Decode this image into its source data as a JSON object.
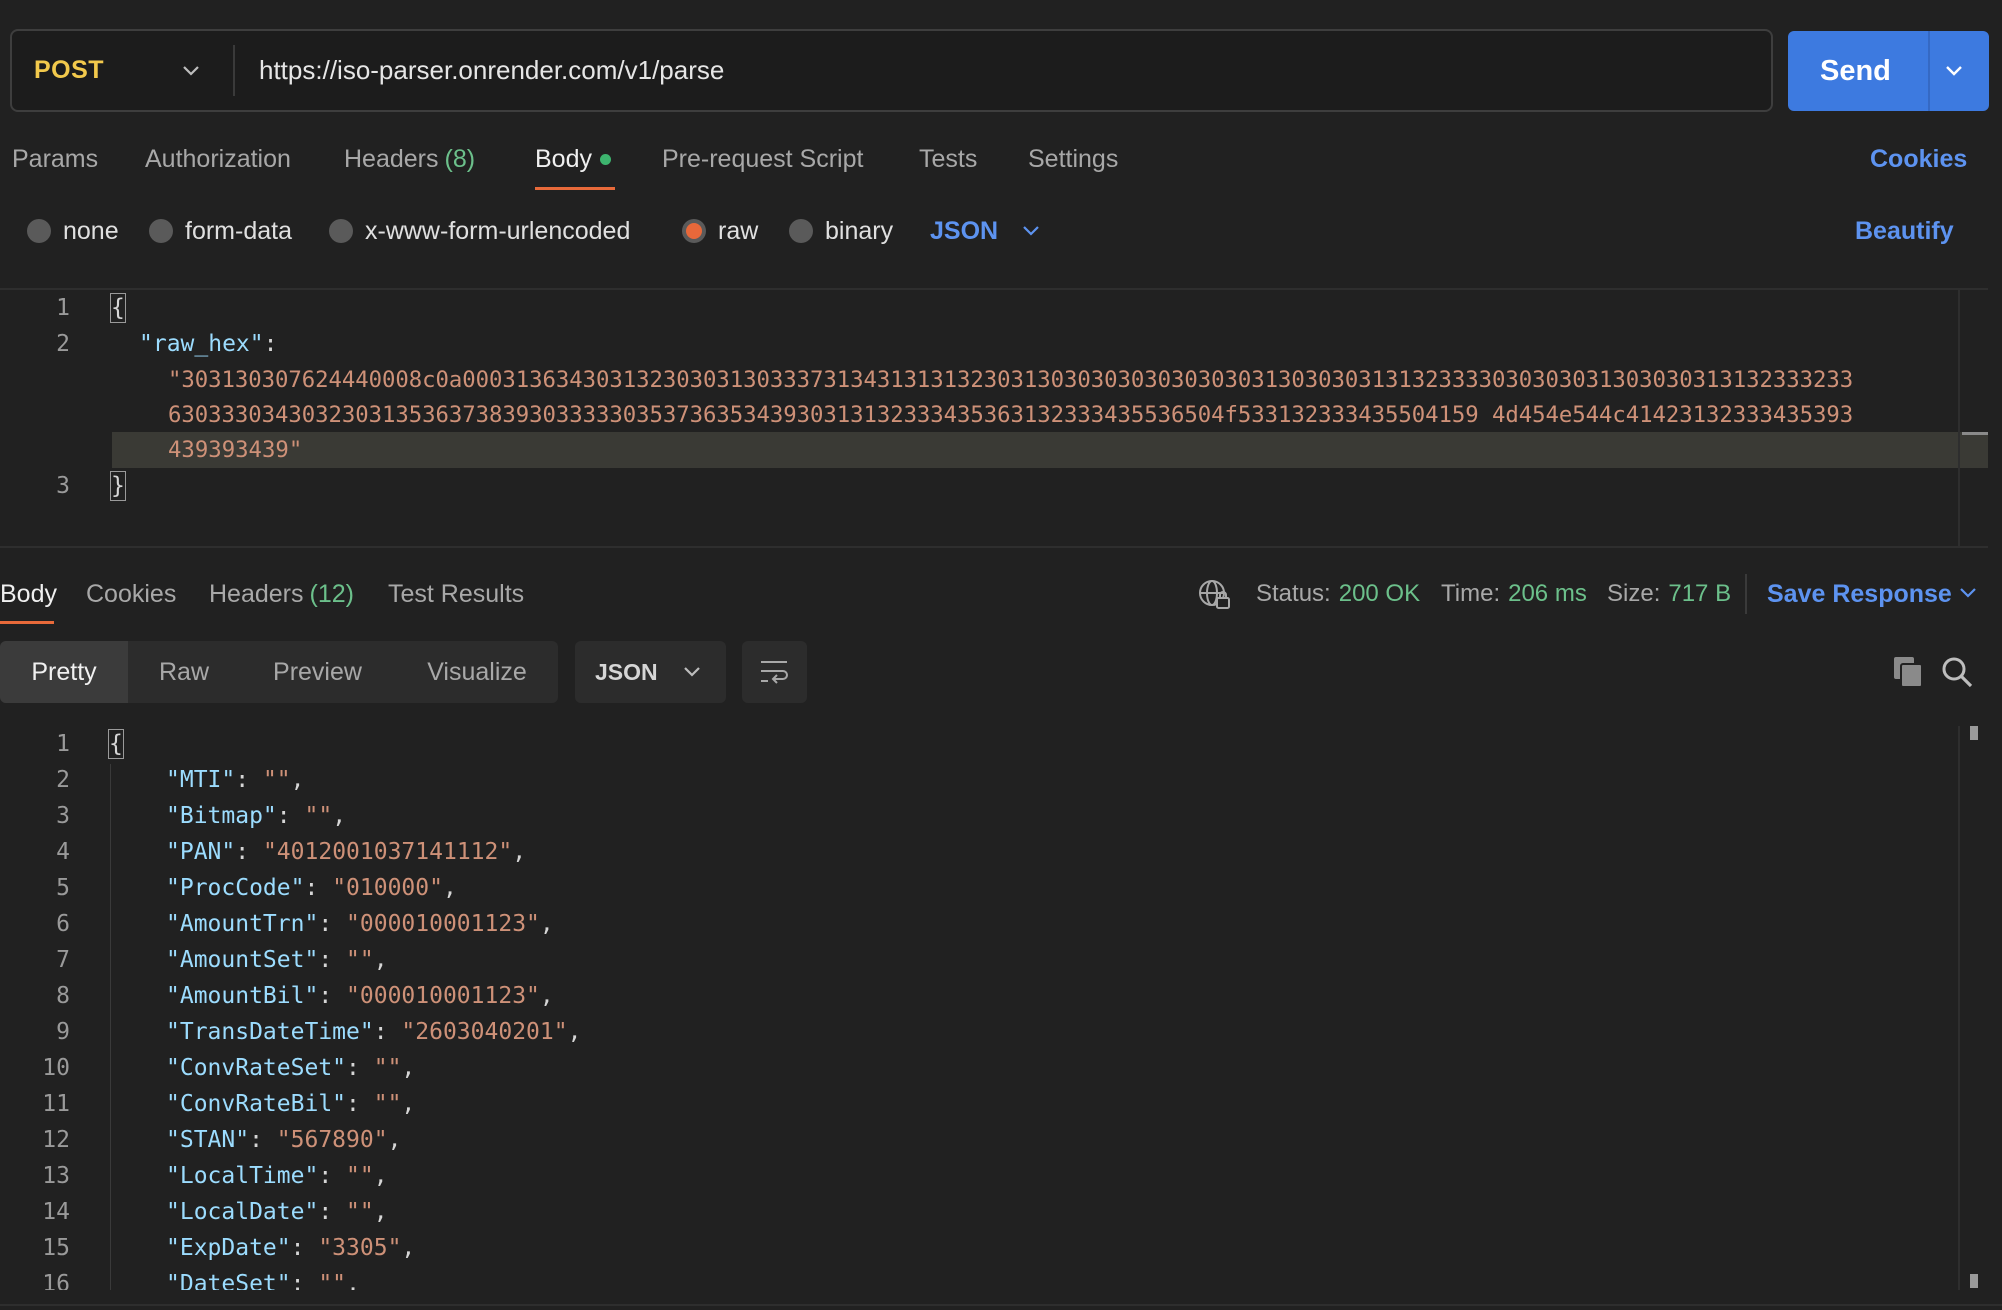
{
  "request": {
    "method": "POST",
    "url": "https://iso-parser.onrender.com/v1/parse",
    "send_label": "Send"
  },
  "tabs": {
    "params": "Params",
    "authorization": "Authorization",
    "headers": "Headers",
    "headers_count": "(8)",
    "body": "Body",
    "pre_request": "Pre-request Script",
    "tests": "Tests",
    "settings": "Settings",
    "cookies": "Cookies"
  },
  "body_types": {
    "none": "none",
    "form_data": "form-data",
    "urlencoded": "x-www-form-urlencoded",
    "raw": "raw",
    "binary": "binary",
    "selected": "raw",
    "format": "JSON",
    "beautify": "Beautify"
  },
  "request_body": {
    "line_numbers": [
      "1",
      "2",
      "3"
    ],
    "open_brace": "{",
    "key": "\"raw_hex\"",
    "colon": ":",
    "value_line1": "\"303130307624440008c0a00031363430313230303130333731343131313230313030303030303030313030303131323333030303031303030313132333233",
    "value_line2": "6303330343032303135363738393033333035373635343930313132333435363132333435536504f533132333435504159 4d454e544c41423132333435393",
    "value_line3": "439393439\"",
    "close_brace": "}"
  },
  "response": {
    "tabs": {
      "body": "Body",
      "cookies": "Cookies",
      "headers": "Headers",
      "headers_count": "(12)",
      "test_results": "Test Results"
    },
    "status_label": "Status:",
    "status_value": "200 OK",
    "time_label": "Time:",
    "time_value": "206 ms",
    "size_label": "Size:",
    "size_value": "717 B",
    "save_label": "Save Response",
    "views": {
      "pretty": "Pretty",
      "raw": "Raw",
      "preview": "Preview",
      "visualize": "Visualize",
      "format": "JSON"
    },
    "open_brace": "{",
    "lines": [
      {
        "n": "2",
        "key": "\"MTI\"",
        "value": "\"\""
      },
      {
        "n": "3",
        "key": "\"Bitmap\"",
        "value": "\"\""
      },
      {
        "n": "4",
        "key": "\"PAN\"",
        "value": "\"4012001037141112\""
      },
      {
        "n": "5",
        "key": "\"ProcCode\"",
        "value": "\"010000\""
      },
      {
        "n": "6",
        "key": "\"AmountTrn\"",
        "value": "\"000010001123\""
      },
      {
        "n": "7",
        "key": "\"AmountSet\"",
        "value": "\"\""
      },
      {
        "n": "8",
        "key": "\"AmountBil\"",
        "value": "\"000010001123\""
      },
      {
        "n": "9",
        "key": "\"TransDateTime\"",
        "value": "\"2603040201\""
      },
      {
        "n": "10",
        "key": "\"ConvRateSet\"",
        "value": "\"\""
      },
      {
        "n": "11",
        "key": "\"ConvRateBil\"",
        "value": "\"\""
      },
      {
        "n": "12",
        "key": "\"STAN\"",
        "value": "\"567890\""
      },
      {
        "n": "13",
        "key": "\"LocalTime\"",
        "value": "\"\""
      },
      {
        "n": "14",
        "key": "\"LocalDate\"",
        "value": "\"\""
      },
      {
        "n": "15",
        "key": "\"ExpDate\"",
        "value": "\"3305\""
      },
      {
        "n": "16",
        "key": "\"DateSet\"",
        "value": "\"\""
      }
    ]
  }
}
